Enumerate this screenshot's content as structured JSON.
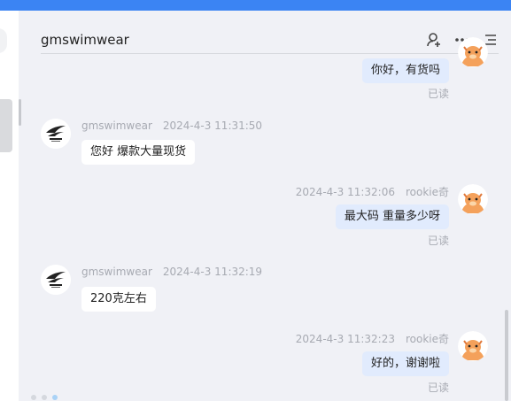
{
  "header": {
    "title": "gmswimwear"
  },
  "icons": [
    "add-user-icon",
    "more-icon",
    "list-menu-icon"
  ],
  "colors": {
    "accent": "#3b84f3",
    "out_bubble": "#e1ebfd",
    "in_bubble": "#ffffff",
    "background": "#f0f1f6"
  },
  "messages": [
    {
      "text": "你好，有货吗",
      "status": "已读"
    },
    {
      "sender": "gmswimwear",
      "time": "2024-4-3 11:31:50",
      "text": "您好  爆款大量现货"
    },
    {
      "sender": "rookie奇",
      "time": "2024-4-3 11:32:06",
      "text": "最大码 重量多少呀",
      "status": "已读"
    },
    {
      "sender": "gmswimwear",
      "time": "2024-4-3 11:32:19",
      "text": "220克左右"
    },
    {
      "sender": "rookie奇",
      "time": "2024-4-3 11:32:23",
      "text": "好的，谢谢啦",
      "status": "已读"
    }
  ]
}
